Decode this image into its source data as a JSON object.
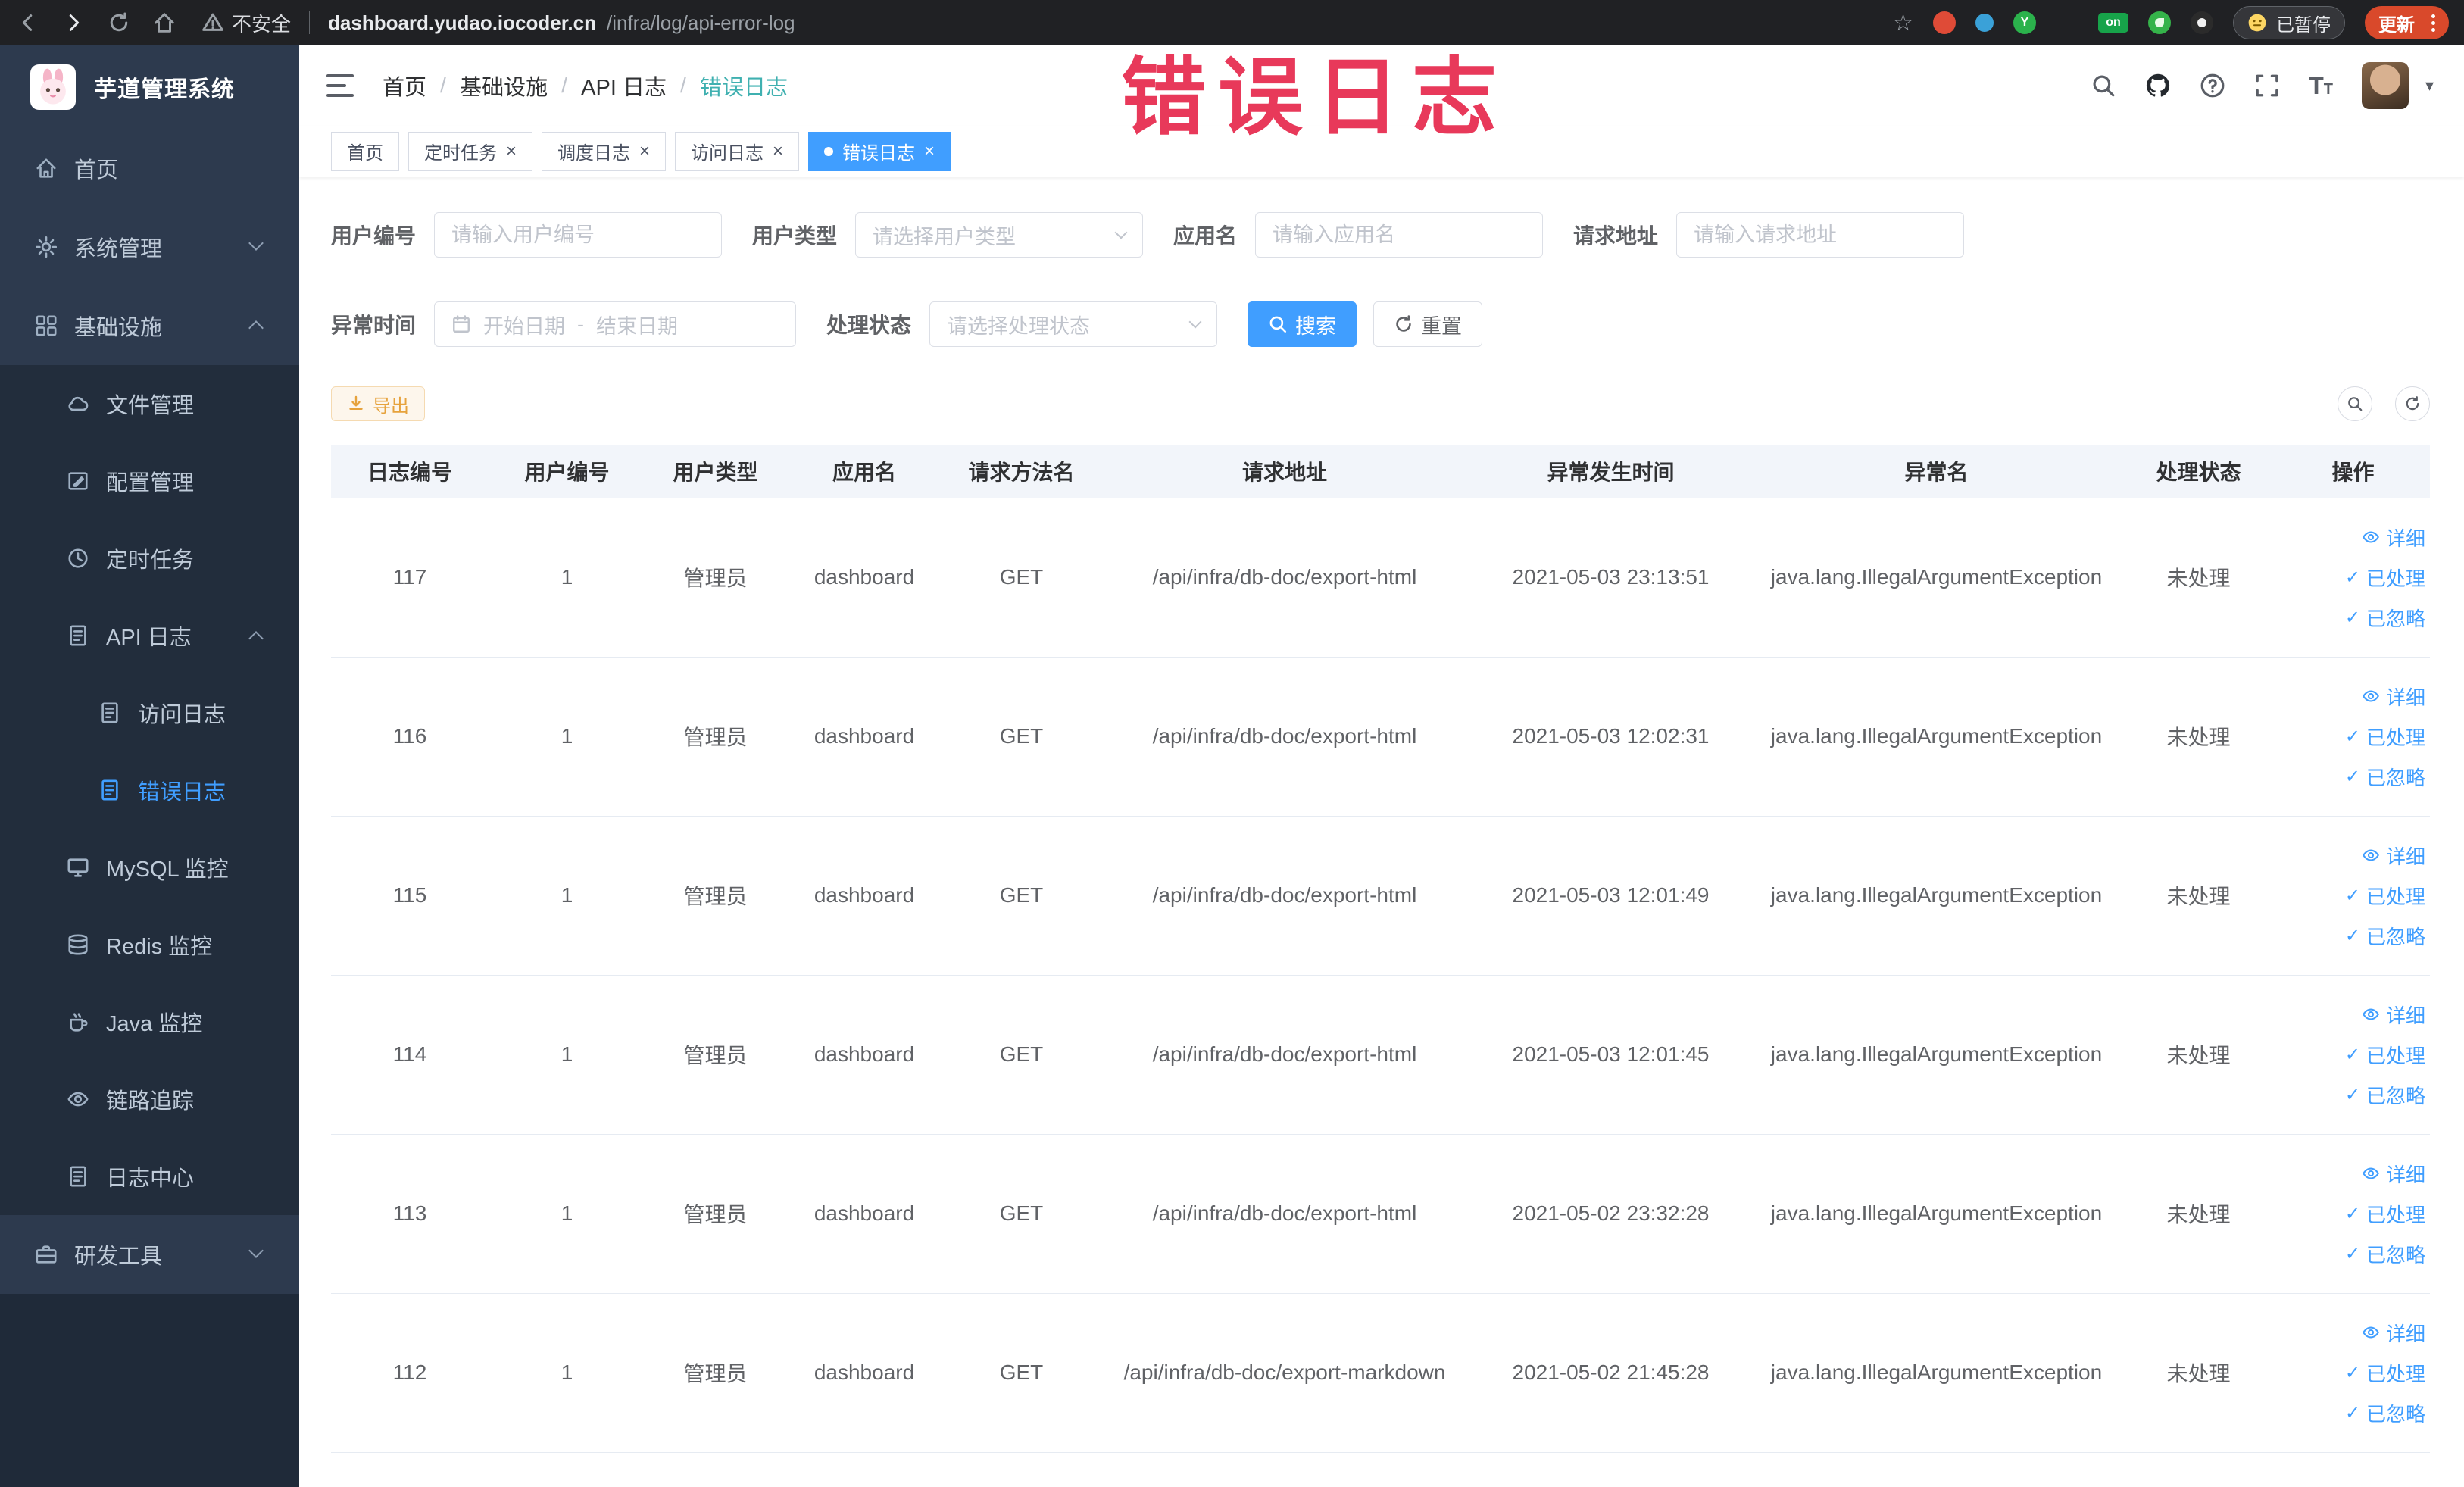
{
  "browser": {
    "security_label": "不安全",
    "url_host": "dashboard.yudao.iocoder.cn",
    "url_path": "/infra/log/api-error-log",
    "extension_on_badge": "on",
    "paused_badge": "已暂停",
    "update_button": "更新"
  },
  "annotation": {
    "text": "错误日志"
  },
  "sidebar": {
    "logo_title": "芋道管理系统",
    "items": [
      {
        "label": "首页"
      },
      {
        "label": "系统管理"
      },
      {
        "label": "基础设施"
      },
      {
        "label": "文件管理"
      },
      {
        "label": "配置管理"
      },
      {
        "label": "定时任务"
      },
      {
        "label": "API 日志"
      },
      {
        "label": "访问日志"
      },
      {
        "label": "错误日志"
      },
      {
        "label": "MySQL 监控"
      },
      {
        "label": "Redis 监控"
      },
      {
        "label": "Java 监控"
      },
      {
        "label": "链路追踪"
      },
      {
        "label": "日志中心"
      },
      {
        "label": "研发工具"
      }
    ]
  },
  "header": {
    "breadcrumb": [
      "首页",
      "基础设施",
      "API 日志",
      "错误日志"
    ]
  },
  "tabs": [
    {
      "label": "首页"
    },
    {
      "label": "定时任务"
    },
    {
      "label": "调度日志"
    },
    {
      "label": "访问日志"
    },
    {
      "label": "错误日志"
    }
  ],
  "filters": {
    "user_id": {
      "label": "用户编号",
      "placeholder": "请输入用户编号"
    },
    "user_type": {
      "label": "用户类型",
      "placeholder": "请选择用户类型"
    },
    "app_name": {
      "label": "应用名",
      "placeholder": "请输入应用名"
    },
    "request_url": {
      "label": "请求地址",
      "placeholder": "请输入请求地址"
    },
    "exception_time": {
      "label": "异常时间",
      "start_placeholder": "开始日期",
      "end_placeholder": "结束日期",
      "separator": "-"
    },
    "process_status": {
      "label": "处理状态",
      "placeholder": "请选择处理状态"
    },
    "search_button": "搜索",
    "reset_button": "重置"
  },
  "toolbar": {
    "export_button": "导出"
  },
  "table": {
    "columns": [
      "日志编号",
      "用户编号",
      "用户类型",
      "应用名",
      "请求方法名",
      "请求地址",
      "异常发生时间",
      "异常名",
      "处理状态",
      "操作"
    ],
    "actions": {
      "detail": "详细",
      "processed": "已处理",
      "ignored": "已忽略"
    },
    "rows": [
      {
        "id": "117",
        "user_id": "1",
        "user_type": "管理员",
        "app": "dashboard",
        "method": "GET",
        "url": "/api/infra/db-doc/export-html",
        "time": "2021-05-03 23:13:51",
        "exception": "java.lang.IllegalArgumentException",
        "status": "未处理"
      },
      {
        "id": "116",
        "user_id": "1",
        "user_type": "管理员",
        "app": "dashboard",
        "method": "GET",
        "url": "/api/infra/db-doc/export-html",
        "time": "2021-05-03 12:02:31",
        "exception": "java.lang.IllegalArgumentException",
        "status": "未处理"
      },
      {
        "id": "115",
        "user_id": "1",
        "user_type": "管理员",
        "app": "dashboard",
        "method": "GET",
        "url": "/api/infra/db-doc/export-html",
        "time": "2021-05-03 12:01:49",
        "exception": "java.lang.IllegalArgumentException",
        "status": "未处理"
      },
      {
        "id": "114",
        "user_id": "1",
        "user_type": "管理员",
        "app": "dashboard",
        "method": "GET",
        "url": "/api/infra/db-doc/export-html",
        "time": "2021-05-03 12:01:45",
        "exception": "java.lang.IllegalArgumentException",
        "status": "未处理"
      },
      {
        "id": "113",
        "user_id": "1",
        "user_type": "管理员",
        "app": "dashboard",
        "method": "GET",
        "url": "/api/infra/db-doc/export-html",
        "time": "2021-05-02 23:32:28",
        "exception": "java.lang.IllegalArgumentException",
        "status": "未处理"
      },
      {
        "id": "112",
        "user_id": "1",
        "user_type": "管理员",
        "app": "dashboard",
        "method": "GET",
        "url": "/api/infra/db-doc/export-markdown",
        "time": "2021-05-02 21:45:28",
        "exception": "java.lang.IllegalArgumentException",
        "status": "未处理"
      }
    ]
  }
}
